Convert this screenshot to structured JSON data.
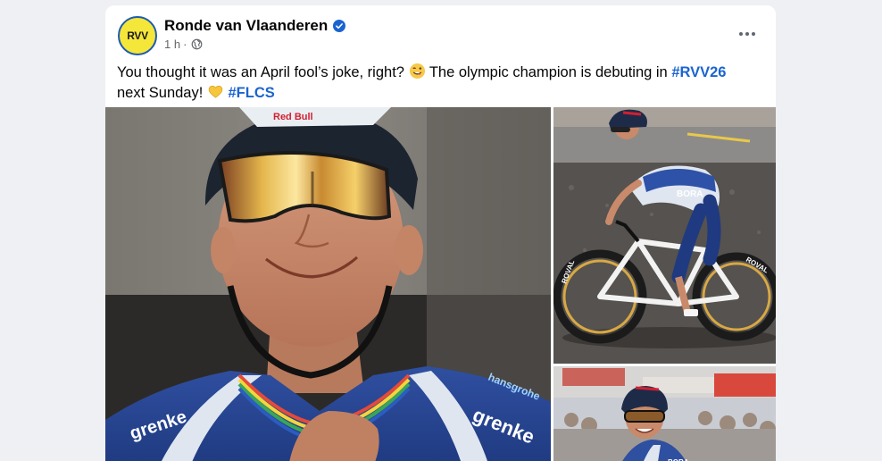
{
  "post": {
    "page_name": "Ronde van Vlaanderen",
    "avatar_text": "RVV",
    "time": "1 h",
    "separator": "·",
    "text_part1": "You thought it was an April fool’s joke, right? ",
    "text_part2": " The olympic champion is debuting in ",
    "hashtag1": "#RVV26",
    "text_part3": " next Sunday! ",
    "hashtag2": "#FLCS"
  },
  "icons": {
    "verified": "verified-badge-icon",
    "audience": "globe-icon",
    "more": "more-options-icon",
    "emoji1": "winking-tongue-emoji",
    "emoji2": "yellow-heart-emoji"
  },
  "photo_text": {
    "redbull": "Red Bull",
    "grenke": "grenke",
    "bora": "BORA",
    "roval": "ROVAL",
    "hansgrohe": "hansgrohe"
  },
  "colors": {
    "hashtag": "#1b64d0",
    "avatar_bg": "#f5e63a",
    "verified": "#1b64d0"
  }
}
